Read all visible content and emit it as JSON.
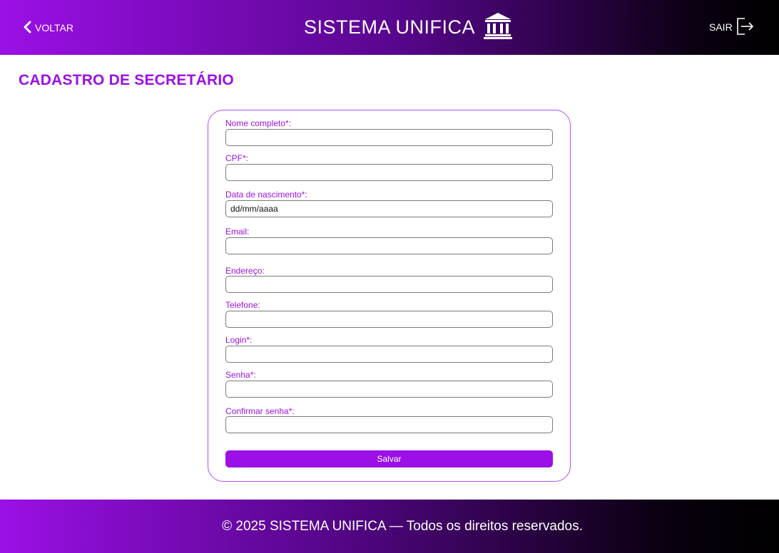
{
  "header": {
    "back_label": "VOLTAR",
    "back_icon": "chevron-left-icon",
    "title": "SISTEMA UNIFICA",
    "brand_icon": "bank-icon",
    "logout_label": "SAIR",
    "logout_icon": "logout-icon"
  },
  "page": {
    "title": "CADASTRO DE SECRETÁRIO"
  },
  "form": {
    "fields": [
      {
        "label": "Nome completo*:",
        "value": "",
        "placeholder": ""
      },
      {
        "label": "CPF*:",
        "value": "",
        "placeholder": ""
      },
      {
        "label": "Data de nascimento*:",
        "value": "",
        "placeholder": "dd/mm/aaaa"
      },
      {
        "label": "Email:",
        "value": "",
        "placeholder": ""
      },
      {
        "label": "Endereço:",
        "value": "",
        "placeholder": ""
      },
      {
        "label": "Telefone:",
        "value": "",
        "placeholder": ""
      },
      {
        "label": "Login*:",
        "value": "",
        "placeholder": ""
      },
      {
        "label": "Senha*:",
        "value": "",
        "placeholder": ""
      },
      {
        "label": "Confirmar senha*:",
        "value": "",
        "placeholder": ""
      }
    ],
    "save_label": "Salvar"
  },
  "footer": {
    "text": "© 2025 SISTEMA UNIFICA — Todos os direitos reservados."
  },
  "colors": {
    "accent": "#9b10e6",
    "gradient_start": "#9b10e6",
    "gradient_end": "#000000"
  }
}
